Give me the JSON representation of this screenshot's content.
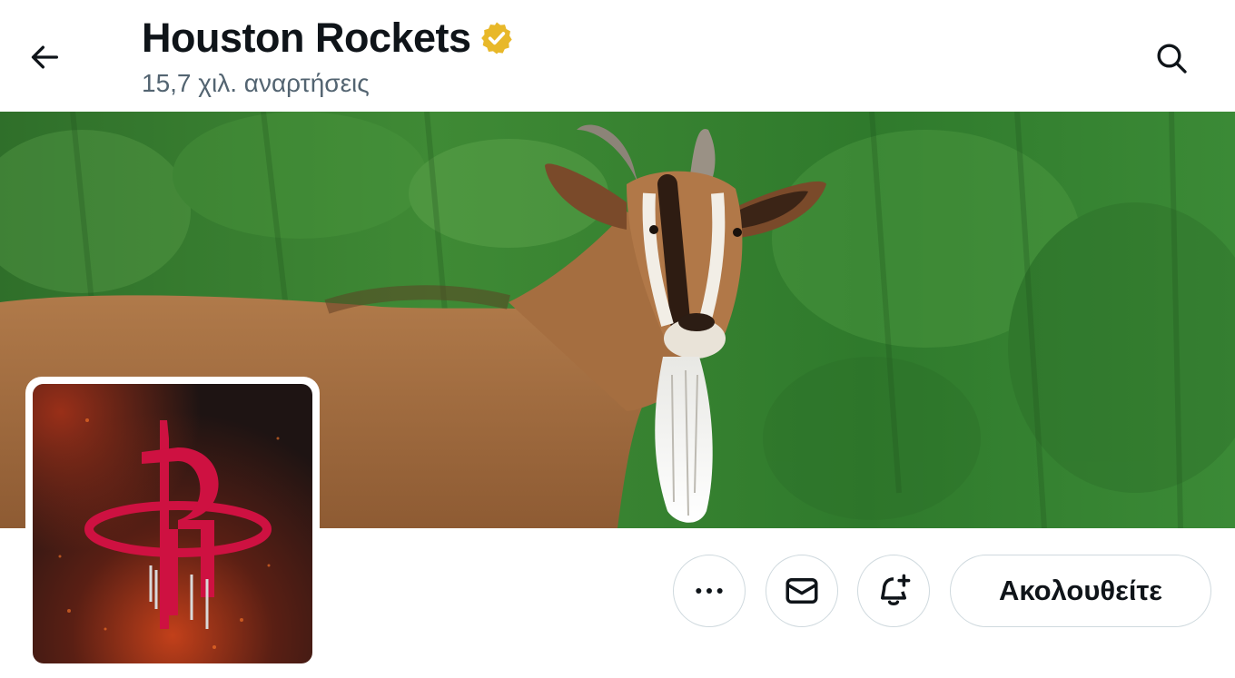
{
  "header": {
    "back_icon": "arrow-left-icon",
    "title": "Houston Rockets",
    "verified_icon": "verified-badge-icon",
    "post_count": "15,7 χιλ. αναρτήσεις",
    "search_icon": "search-icon"
  },
  "banner": {
    "description_icon": "banner-image"
  },
  "avatar": {
    "logo_icon": "rockets-logo-icon"
  },
  "actions": {
    "more_icon": "more-icon",
    "message_icon": "envelope-icon",
    "notify_icon": "bell-plus-icon",
    "follow_label": "Ακολουθείτε"
  },
  "colors": {
    "verified_gold": "#e8b829",
    "rockets_red": "#ce1141",
    "text_primary": "#0f1419",
    "text_secondary": "#536471",
    "border": "#cfd9de"
  }
}
